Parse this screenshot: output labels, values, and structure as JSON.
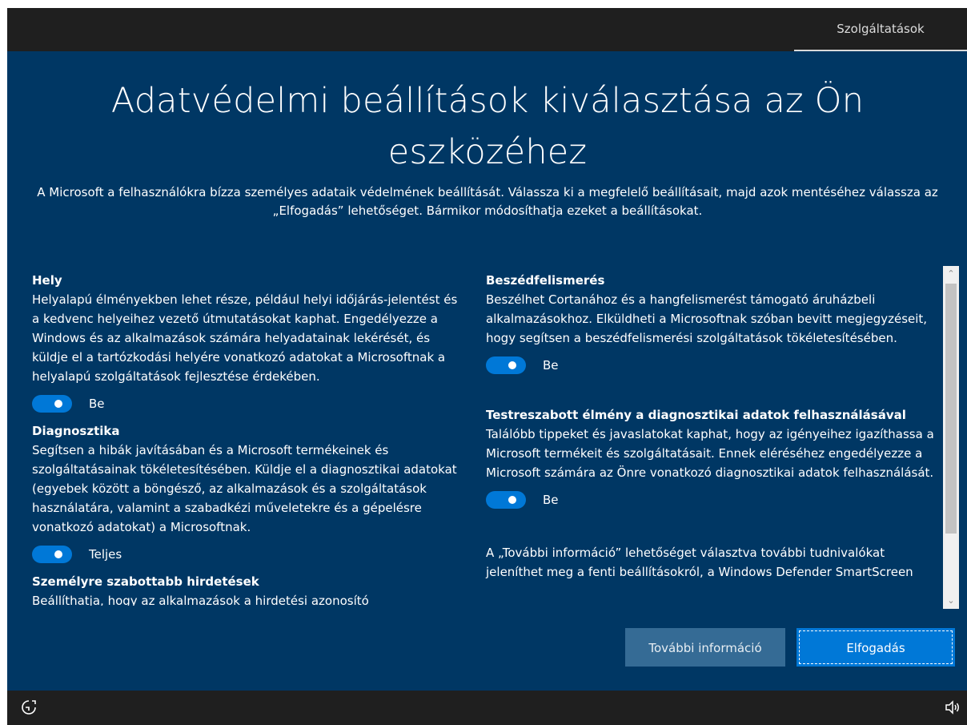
{
  "topbar": {
    "tab_label": "Szolgáltatások"
  },
  "header": {
    "title": "Adatvédelmi beállítások kiválasztása az Ön eszközéhez",
    "subtitle": "A Microsoft a felhasználókra bízza személyes adataik védelmének beállítását. Válassza ki a megfelelő beállításait, majd azok mentéséhez válassza az „Elfogadás” lehetőséget. Bármikor módosíthatja ezeket a beállításokat."
  },
  "left_sections": [
    {
      "title": "Hely",
      "body": "Helyalapú élményekben lehet része, például helyi időjárás-jelentést és a kedvenc helyeihez vezető útmutatásokat kaphat. Engedélyezze a Windows és az alkalmazások számára helyadatainak lekérését, és küldje el a tartózkodási helyére vonatkozó adatokat a Microsoftnak a helyalapú szolgáltatások fejlesztése érdekében.",
      "toggle_label": "Be"
    },
    {
      "title": "Diagnosztika",
      "body": "Segítsen a hibák javításában és a Microsoft termékeinek és szolgáltatásainak tökéletesítésében. Küldje el a diagnosztikai adatokat (egyebek között a böngésző, az alkalmazások és a szolgáltatások használatára, valamint a szabadkézi műveletekre és a gépelésre vonatkozó adatokat) a Microsoftnak.",
      "toggle_label": "Teljes"
    },
    {
      "title": "Személyre szabottabb hirdetések",
      "body": "Beállíthatja, hogy az alkalmazások a hirdetési azonosító"
    }
  ],
  "right_sections": [
    {
      "title": "Beszédfelismerés",
      "body": "Beszélhet Cortanához és a hangfelismerést támogató áruházbeli alkalmazásokhoz. Elküldheti a Microsoftnak szóban bevitt megjegyzéseit, hogy segítsen a beszédfelismerési szolgáltatások tökéletesítésében.",
      "toggle_label": "Be"
    },
    {
      "title": "Testreszabott élmény a diagnosztikai adatok felhasználásával",
      "body": "Találóbb tippeket és javaslatokat kaphat, hogy az igényeihez igazíthassa a Microsoft termékeit és szolgáltatásait. Ennek eléréséhez engedélyezze a Microsoft számára az Önre vonatkozó diagnosztikai adatok felhasználását.",
      "toggle_label": "Be"
    },
    {
      "title": "",
      "body": "A „További információ” lehetőséget választva további tudnivalókat jeleníthet meg a fenti beállításokról, a Windows Defender SmartScreen"
    }
  ],
  "buttons": {
    "more_info_label": "További információ",
    "accept_label": "Elfogadás"
  },
  "icons": {
    "bottom_left": "accessibility-icon",
    "bottom_right": "volume-icon"
  },
  "colors": {
    "background": "#003764",
    "accent": "#0078d7",
    "secondary_button": "#356b95",
    "bar": "#1f1f1f"
  }
}
